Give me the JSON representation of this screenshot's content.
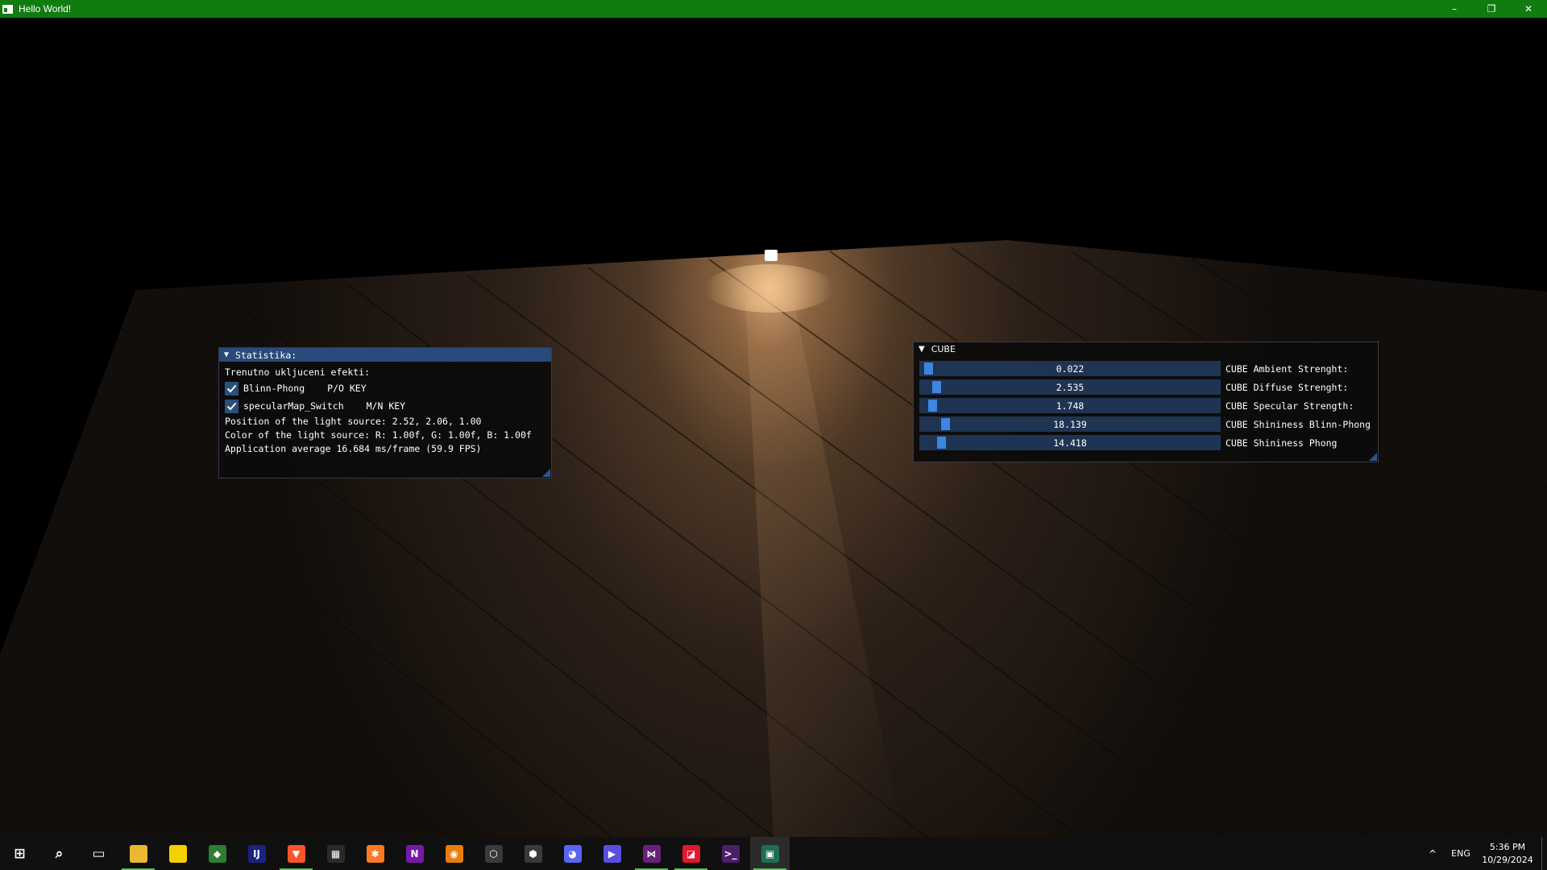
{
  "window": {
    "title": "Hello World!",
    "controls": {
      "minimize": "–",
      "restore": "❐",
      "close": "✕"
    }
  },
  "stats_panel": {
    "title": "Statistika:",
    "effects_heading": "Trenutno ukljuceni efekti:",
    "toggles": [
      {
        "label": "Blinn-Phong",
        "key": "P/O KEY",
        "checked": true
      },
      {
        "label": "specularMap_Switch",
        "key": "M/N KEY",
        "checked": true
      }
    ],
    "light_position": "Position of the light source: 2.52, 2.06, 1.00",
    "light_color": "Color of the light source: R: 1.00f, G: 1.00f, B: 1.00f",
    "fps": "Application average 16.684 ms/frame (59.9 FPS)"
  },
  "cube_panel": {
    "title": "CUBE",
    "sliders": [
      {
        "value": "0.022",
        "label": "CUBE Ambient Strenght:",
        "fraction": 0.01
      },
      {
        "value": "2.535",
        "label": "CUBE Diffuse Strenght:",
        "fraction": 0.04
      },
      {
        "value": "1.748",
        "label": "CUBE Specular Strength:",
        "fraction": 0.025
      },
      {
        "value": "18.139",
        "label": "CUBE Shininess Blinn-Phong",
        "fraction": 0.07
      },
      {
        "value": "14.418",
        "label": "CUBE Shininess Phong",
        "fraction": 0.055
      }
    ]
  },
  "taskbar": {
    "apps": [
      {
        "name": "start-button-icon",
        "glyph": "⊞",
        "color": "#101010",
        "running": false,
        "active": false
      },
      {
        "name": "search-icon",
        "glyph": "⌕",
        "color": "#101010",
        "running": false,
        "active": false
      },
      {
        "name": "task-view-icon",
        "glyph": "▭",
        "color": "#101010",
        "running": false,
        "active": false
      },
      {
        "name": "file-explorer-icon",
        "glyph": "",
        "color": "#e8b830",
        "running": true,
        "active": false
      },
      {
        "name": "sticky-notes-icon",
        "glyph": "",
        "color": "#f5d000",
        "running": false,
        "active": false
      },
      {
        "name": "git-icon",
        "glyph": "◆",
        "color": "#2e7d32",
        "running": false,
        "active": false
      },
      {
        "name": "intellij-icon",
        "glyph": "IJ",
        "color": "#1a237e",
        "running": false,
        "active": false
      },
      {
        "name": "brave-browser-icon",
        "glyph": "▼",
        "color": "#fb542b",
        "running": true,
        "active": false
      },
      {
        "name": "calculator-icon",
        "glyph": "▦",
        "color": "#2a2a2a",
        "running": false,
        "active": false
      },
      {
        "name": "xampp-icon",
        "glyph": "✱",
        "color": "#fb7a24",
        "running": false,
        "active": false
      },
      {
        "name": "onenote-icon",
        "glyph": "N",
        "color": "#7719aa",
        "running": false,
        "active": false
      },
      {
        "name": "blender-icon",
        "glyph": "◉",
        "color": "#e87d0d",
        "running": false,
        "active": false
      },
      {
        "name": "unity-hub-icon",
        "glyph": "⬡",
        "color": "#3a3a3a",
        "running": false,
        "active": false
      },
      {
        "name": "unity-icon",
        "glyph": "⬢",
        "color": "#3a3a3a",
        "running": false,
        "active": false
      },
      {
        "name": "discord-icon",
        "glyph": "◕",
        "color": "#5865f2",
        "running": false,
        "active": false
      },
      {
        "name": "media-player-icon",
        "glyph": "▶",
        "color": "#5b4de0",
        "running": false,
        "active": false
      },
      {
        "name": "visual-studio-icon",
        "glyph": "⋈",
        "color": "#68217a",
        "running": true,
        "active": false
      },
      {
        "name": "amd-software-icon",
        "glyph": "◪",
        "color": "#e0182d",
        "running": true,
        "active": false
      },
      {
        "name": "terminal-icon",
        "glyph": ">_",
        "color": "#4b1f6a",
        "running": false,
        "active": false
      },
      {
        "name": "opengl-app-icon",
        "glyph": "▣",
        "color": "#1e6e52",
        "running": true,
        "active": true
      }
    ],
    "tray": {
      "chevron": "^",
      "language": "ENG",
      "time": "5:36 PM",
      "date": "10/29/2024"
    }
  }
}
